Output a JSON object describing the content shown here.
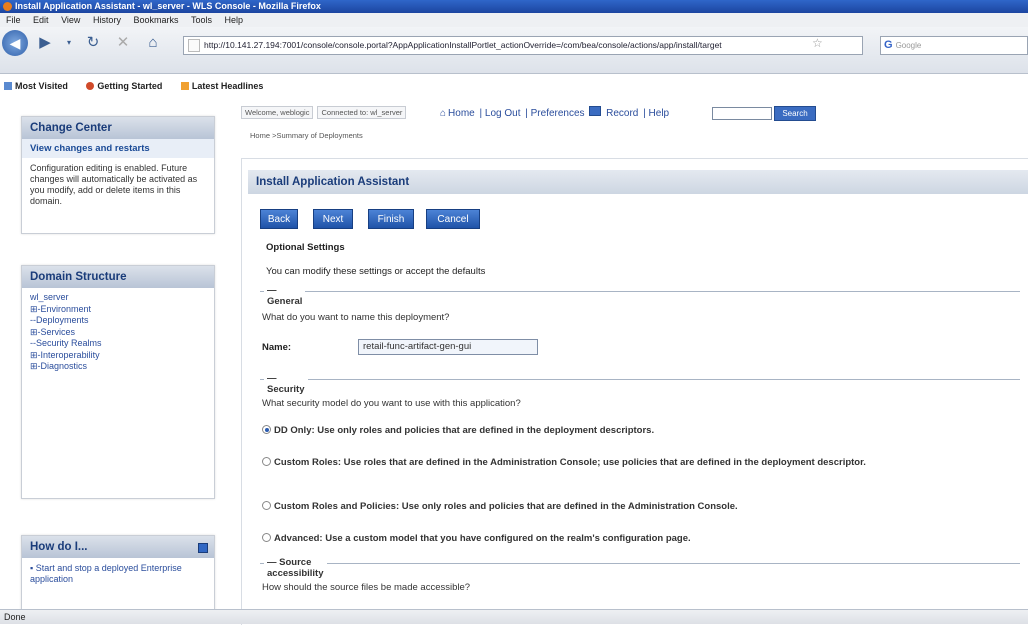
{
  "window": {
    "title": "Install Application Assistant - wl_server - WLS Console - Mozilla Firefox"
  },
  "menu": [
    "File",
    "Edit",
    "View",
    "History",
    "Bookmarks",
    "Tools",
    "Help"
  ],
  "nav": {
    "url": "http://10.141.27.194:7001/console/console.portal?AppApplicationInstallPortlet_actionOverride=/com/bea/console/actions/app/install/target",
    "search_placeholder": "Google"
  },
  "bookmarks": [
    "Most Visited",
    "Getting Started",
    "Latest Headlines"
  ],
  "change_center": {
    "title": "Change Center",
    "link": "View changes and restarts",
    "message": "Configuration editing is enabled. Future changes will automatically be activated as you modify, add or delete items in this domain."
  },
  "domain_structure": {
    "title": "Domain Structure",
    "items": [
      "wl_server",
      "⊞-Environment",
      "--Deployments",
      "⊞-Services",
      "--Security Realms",
      "⊞-Interoperability",
      "⊞-Diagnostics"
    ]
  },
  "howdo": {
    "title": "How do I...",
    "items": [
      "Start and stop a deployed Enterprise application"
    ]
  },
  "header": {
    "welcome": "Welcome, weblogic",
    "connected": "Connected to: wl_server",
    "links": [
      "Home",
      "Log Out",
      "Preferences",
      "Record",
      "Help"
    ],
    "search_button": "Search",
    "breadcrumb": "Home >Summary of Deployments"
  },
  "assistant": {
    "title": "Install Application Assistant",
    "buttons": [
      "Back",
      "Next",
      "Finish",
      "Cancel"
    ],
    "optional_title": "Optional Settings",
    "optional_desc": "You can modify these settings or accept the defaults",
    "general_label": "General",
    "name_question": "What do you want to name this deployment?",
    "name_label": "Name:",
    "name_value": "retail-func-artifact-gen-gui",
    "security_label": "Security",
    "security_question": "What security model do you want to use with this application?",
    "security_options": [
      "DD Only: Use only roles and policies that are defined in the deployment descriptors.",
      "Custom Roles: Use roles that are defined in the Administration Console; use policies that are defined in the deployment descriptor.",
      "Custom Roles and Policies: Use only roles and policies that are defined in the Administration Console.",
      "Advanced: Use a custom model that you have configured on the realm's configuration page."
    ],
    "source_label": "Source accessibility",
    "source_question": "How should the source files be made accessible?"
  },
  "status": "Done",
  "colors": {
    "accent": "#1f53a8",
    "header_text": "#1a3c7a"
  }
}
